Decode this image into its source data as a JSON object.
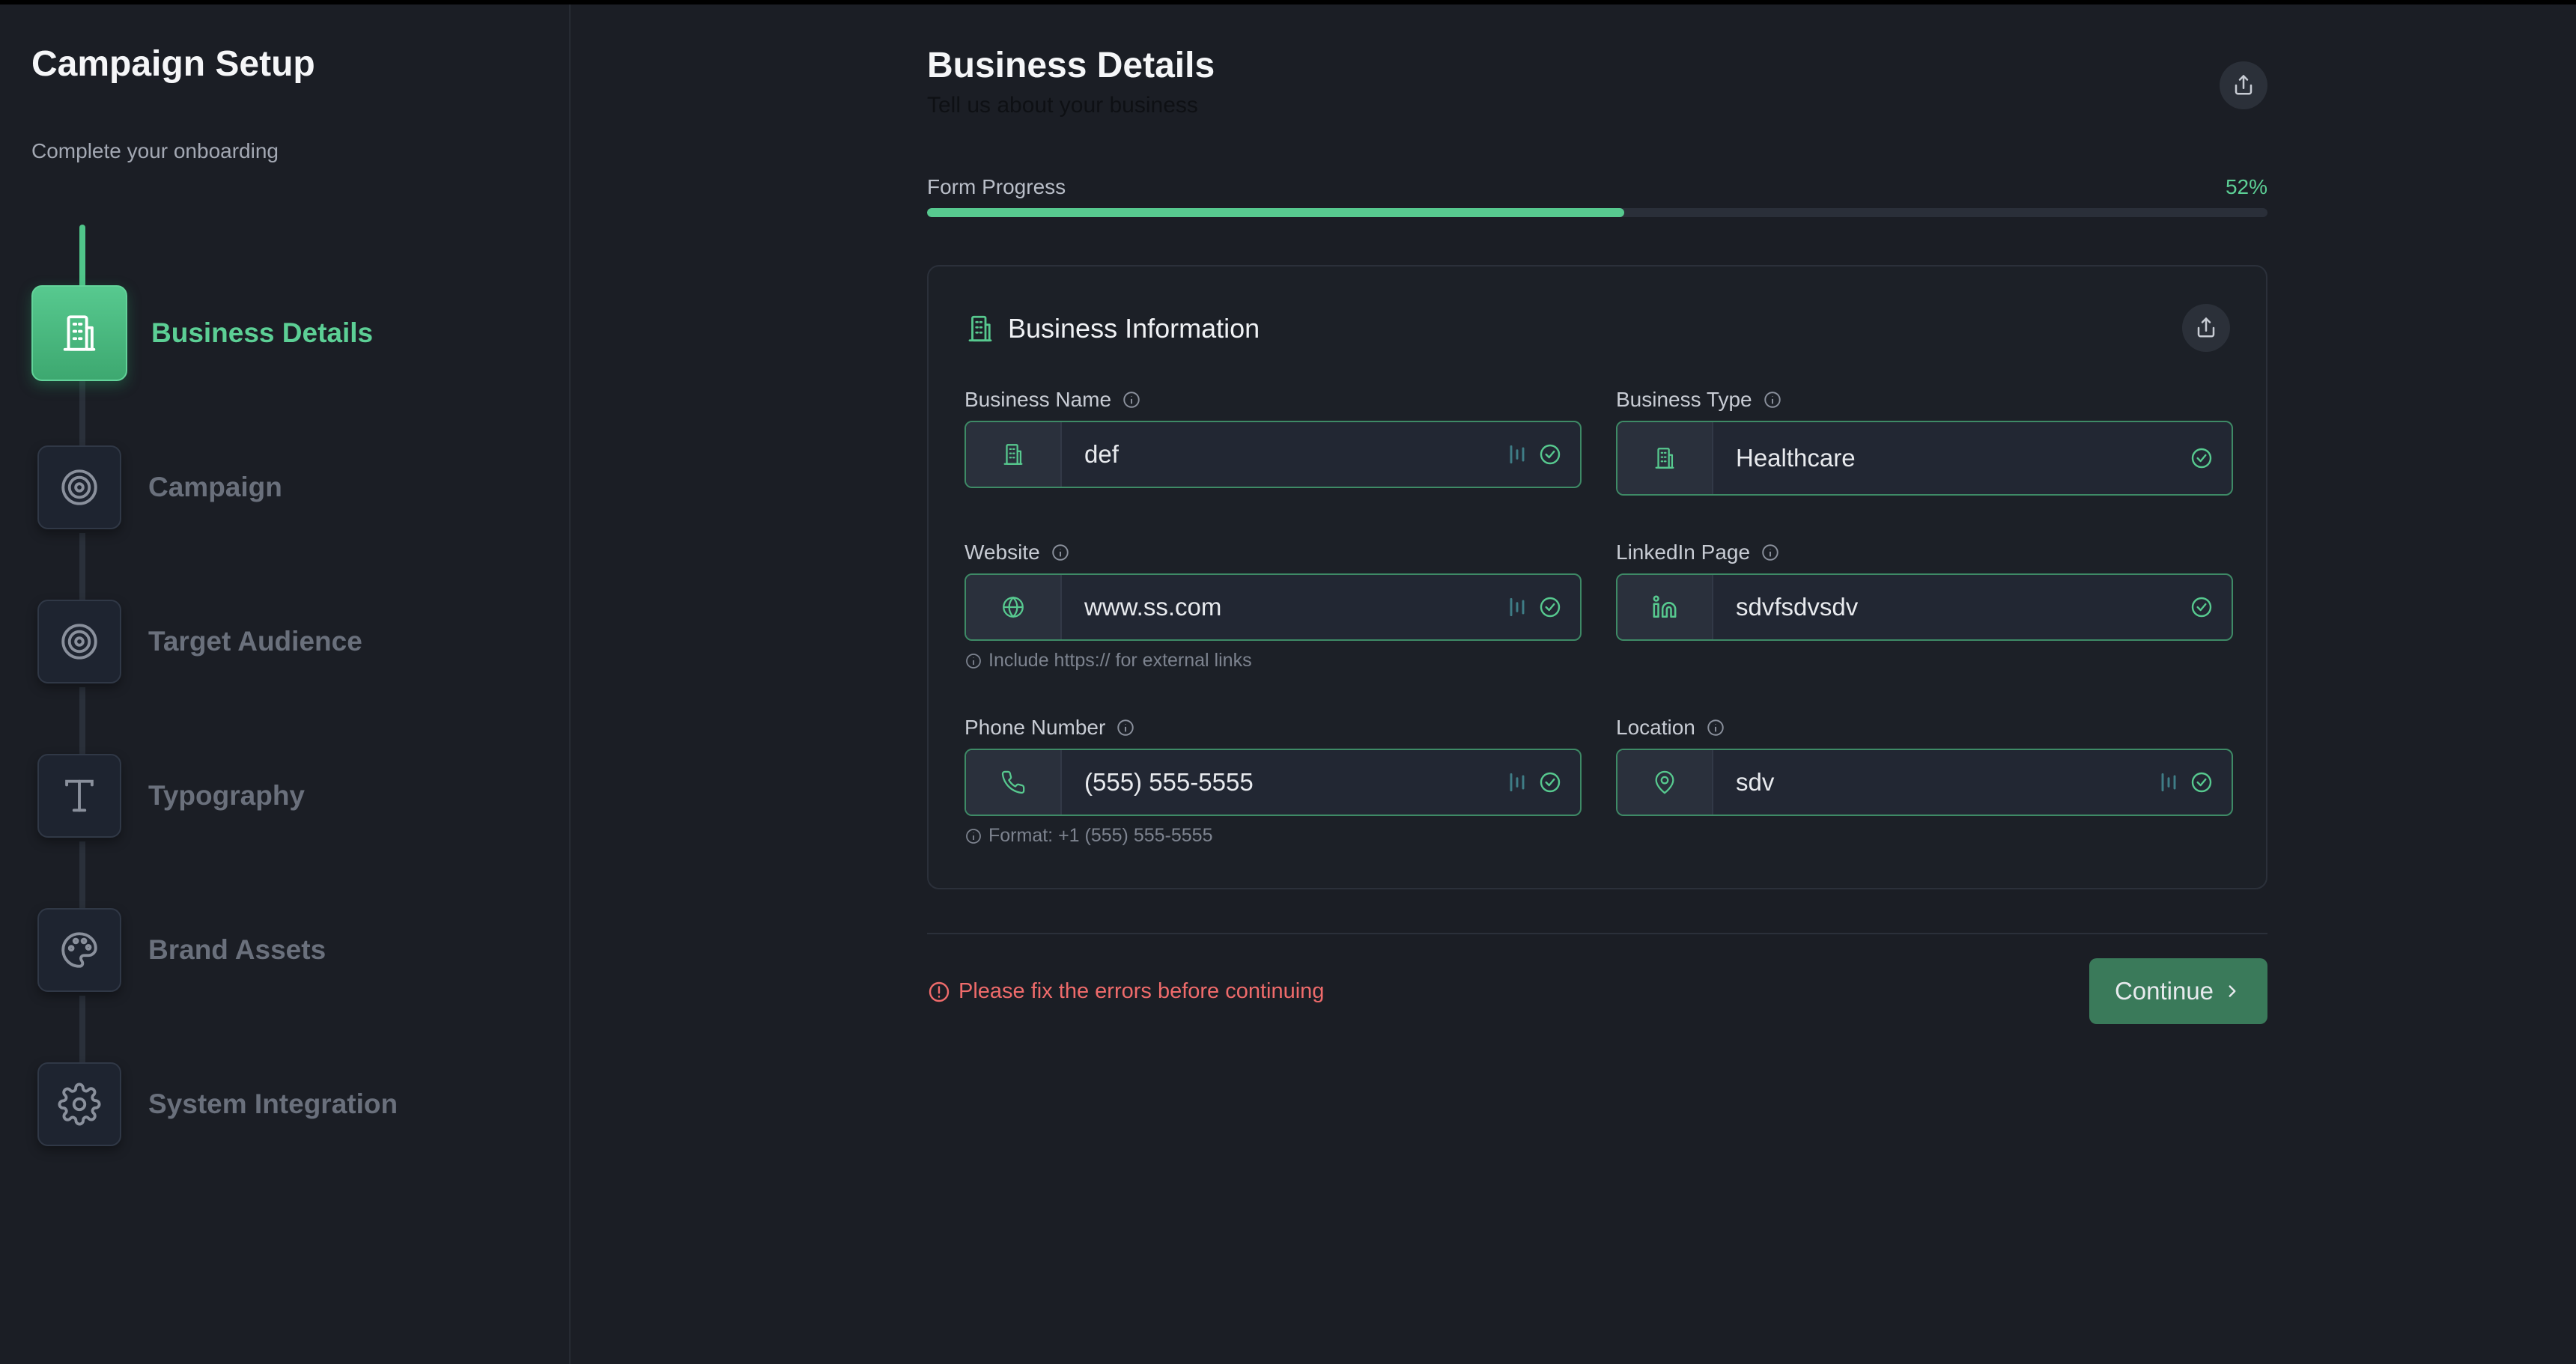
{
  "sidebar": {
    "title": "Campaign Setup",
    "subtitle": "Complete your onboarding",
    "steps": [
      {
        "label": "Business Details",
        "icon": "building-icon",
        "active": true
      },
      {
        "label": "Campaign",
        "icon": "target-icon",
        "active": false
      },
      {
        "label": "Target Audience",
        "icon": "target-icon",
        "active": false
      },
      {
        "label": "Typography",
        "icon": "typography-icon",
        "active": false
      },
      {
        "label": "Brand Assets",
        "icon": "palette-icon",
        "active": false
      },
      {
        "label": "System Integration",
        "icon": "gear-icon",
        "active": false
      }
    ]
  },
  "header": {
    "title": "Business Details",
    "subtitle": "Tell us about your business"
  },
  "progress": {
    "label": "Form Progress",
    "percent_text": "52%",
    "value": 0.52
  },
  "card": {
    "title": "Business Information",
    "fields": {
      "business_name": {
        "label": "Business Name",
        "value": "def"
      },
      "business_type": {
        "label": "Business Type",
        "value": "Healthcare"
      },
      "website": {
        "label": "Website",
        "value": "www.ss.com",
        "hint": "Include https:// for external links"
      },
      "linkedin": {
        "label": "LinkedIn Page",
        "value": "sdvfsdvsdv"
      },
      "phone": {
        "label": "Phone Number",
        "value": "(555) 555-5555",
        "hint": "Format: +1 (555) 555-5555"
      },
      "location": {
        "label": "Location",
        "value": "sdv"
      }
    }
  },
  "footer": {
    "error": "Please fix the errors before continuing",
    "continue_label": "Continue"
  },
  "colors": {
    "accent": "#57c98f",
    "background": "#1b1e25",
    "error": "#ef6b6b",
    "button": "#3a7a5a"
  }
}
